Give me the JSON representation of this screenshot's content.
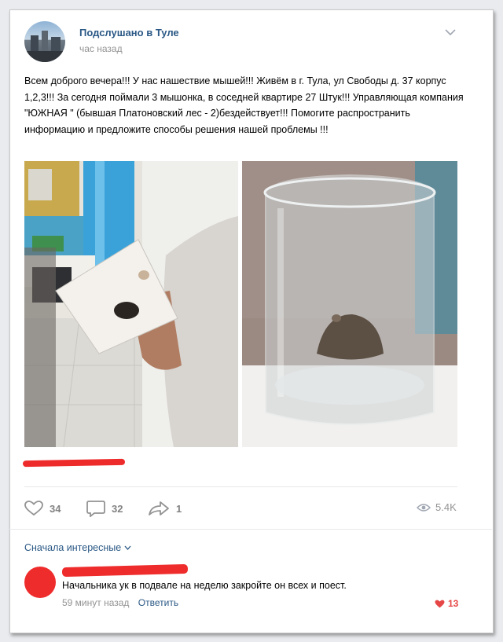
{
  "post": {
    "group_name": "Подслушано в Туле",
    "time": "час назад",
    "text": "Всем доброго вечера!!! У нас нашествие мышей!!! Живём в г. Тула, ул Свободы д. 37 корпус 1,2,3!!! За сегодня поймали 3 мышонка, в соседней квартире 27 Штук!!! Управляющая компания \"ЮЖНАЯ \" (бывшая Платоновский лес - 2)бездействует!!! Помогите распространить информацию и предложите способы решения нашей проблемы !!!"
  },
  "actions": {
    "likes": "34",
    "comments": "32",
    "shares": "1",
    "views": "5.4K"
  },
  "comments_section": {
    "sort_label": "Сначала интересные",
    "comment": {
      "text": "Начальника ук в подвале на неделю закройте он всех и поест.",
      "time": "59 минут назад",
      "reply_label": "Ответить",
      "likes": "13"
    }
  },
  "colors": {
    "link": "#2a5885",
    "muted": "#939393",
    "like_red": "#e64646",
    "redaction": "#ef2c2c"
  },
  "icons": [
    "chevron-down-icon",
    "heart-icon",
    "comment-icon",
    "share-icon",
    "eye-icon"
  ]
}
